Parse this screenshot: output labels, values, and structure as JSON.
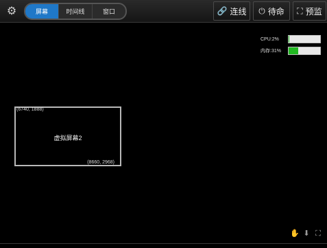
{
  "toolbar": {
    "settings_icon": "gear-icon",
    "tabs": [
      {
        "label": "屏幕",
        "active": true
      },
      {
        "label": "时间线",
        "active": false
      },
      {
        "label": "窗口",
        "active": false
      }
    ],
    "connect_label": "连线",
    "standby_label": "待命",
    "preview_label": "预监"
  },
  "status": {
    "cpu_label": "CPU:2%",
    "cpu_percent": 2,
    "mem_label": "内存:31%",
    "mem_percent": 31,
    "fill_color": "#22b822"
  },
  "canvas": {
    "screen": {
      "name": "虚拟屏幕2",
      "top_left_coord": "(6740, 1888)",
      "bottom_right_coord": "(8660, 2968)"
    }
  },
  "tools": {
    "icons": [
      "hand-icon",
      "download-icon",
      "fit-screen-icon"
    ]
  }
}
